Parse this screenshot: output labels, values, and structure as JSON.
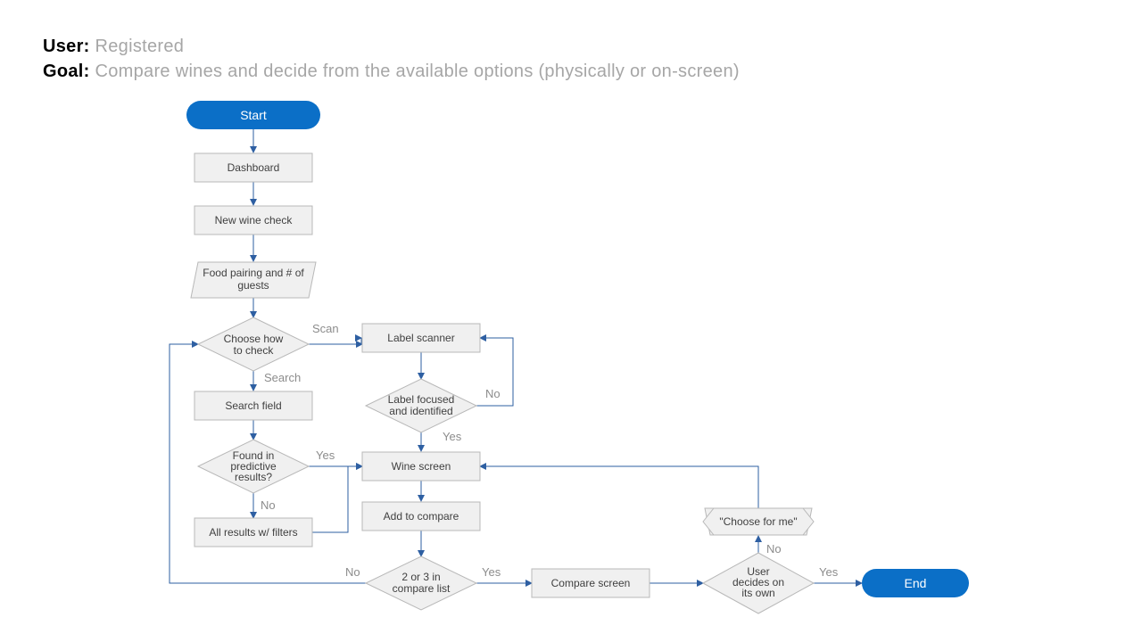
{
  "header": {
    "user_label": "User:",
    "user_value": "Registered",
    "goal_label": "Goal:",
    "goal_value": "Compare wines and decide from the available options (physically or on-screen)"
  },
  "nodes": {
    "start": "Start",
    "dashboard": "Dashboard",
    "new_wine_check": "New wine check",
    "food_pairing_l1": "Food pairing and # of",
    "food_pairing_l2": "guests",
    "choose_how_l1": "Choose how",
    "choose_how_l2": "to check",
    "search_field": "Search field",
    "found_l1": "Found in",
    "found_l2": "predictive",
    "found_l3": "results?",
    "all_results": "All results w/ filters",
    "label_scanner": "Label scanner",
    "label_focused_l1": "Label focused",
    "label_focused_l2": "and identified",
    "wine_screen": "Wine screen",
    "add_to_compare": "Add to compare",
    "two_or_three_l1": "2 or 3 in",
    "two_or_three_l2": "compare list",
    "compare_screen": "Compare screen",
    "user_decides_l1": "User",
    "user_decides_l2": "decides on",
    "user_decides_l3": "its own",
    "choose_for_me": "\"Choose for me\"",
    "end": "End"
  },
  "labels": {
    "scan": "Scan",
    "search": "Search",
    "yes": "Yes",
    "no": "No"
  }
}
